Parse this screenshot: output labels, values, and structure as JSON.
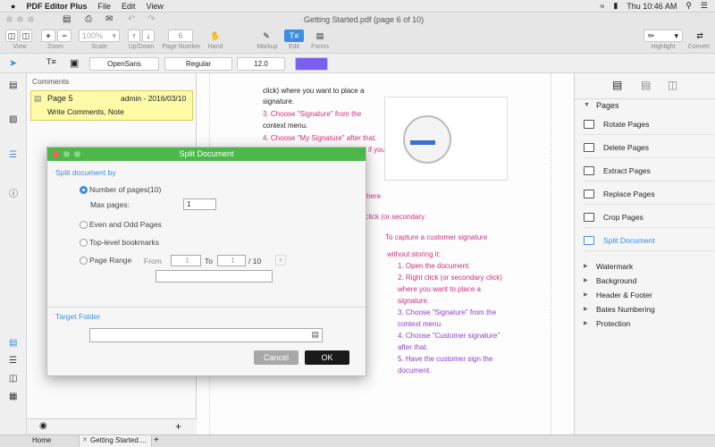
{
  "menubar": {
    "app": "PDF Editor Plus",
    "items": [
      "File",
      "Edit",
      "View"
    ],
    "time": "Thu 10:46 AM"
  },
  "window": {
    "title": "Getting Started.pdf (page 6 of 10)"
  },
  "toolbar": {
    "zoom_value": "100%",
    "page_number": "6",
    "labels": {
      "view": "View",
      "zoom": "Zoom",
      "scale": "Scale",
      "updown": "Up/Down",
      "page_number": "Page Number",
      "hand": "Hand",
      "markup": "Markup",
      "edit": "Edit",
      "forms": "Forms",
      "highlight": "Highlight",
      "convert": "Convert"
    }
  },
  "format": {
    "font": "OpenSans",
    "style": "Regular",
    "size": "12.0",
    "color": "#7b5ff0"
  },
  "comments": {
    "header": "Comments",
    "items": [
      {
        "page": "Page 5",
        "author": "admin - 2016/03/10",
        "text": "Write Comments, Note"
      }
    ]
  },
  "document": {
    "lines_top": [
      "click) where you want to place a",
      "signature.",
      "3. Choose \"Signature\" from the",
      "context menu.",
      "4. Choose \"My Signature\" after that."
    ],
    "partial": [
      "if you",
      "here",
      "t click (or secondary"
    ],
    "lines_bottom": [
      "To capture a customer signature",
      "without storing it:",
      "1. Open the document.",
      "2. Right click (or secondary click)",
      "where you want to place a",
      "signature.",
      "3. Choose \"Signature\" from the",
      "context menu.",
      "4. Choose \"Customer signature\"",
      "after that.",
      "5. Have the customer sign the",
      "document."
    ]
  },
  "dialog": {
    "title": "Split Document",
    "split_by": "Split document by",
    "opt_pages": "Number of pages(10)",
    "max_pages_label": "Max pages:",
    "max_pages": "1",
    "opt_even_odd": "Even and Odd Pages",
    "opt_bookmarks": "Top-level bookmarks",
    "opt_range": "Page Range",
    "from_label": "From",
    "from_val": "1",
    "to_label": "To",
    "to_val": "1",
    "total": "/ 10",
    "target_folder": "Target Folder",
    "cancel": "Cancel",
    "ok": "OK"
  },
  "right_panel": {
    "pages_header": "Pages",
    "items": [
      "Rotate Pages",
      "Delete Pages",
      "Extract Pages",
      "Replace Pages",
      "Crop Pages",
      "Split Document"
    ],
    "sections": [
      "Watermark",
      "Background",
      "Header & Footer",
      "Bates Numbering",
      "Protection"
    ],
    "accent": "#3b8ee0"
  },
  "tabs": {
    "home": "Home",
    "doc": "Getting Started...."
  }
}
